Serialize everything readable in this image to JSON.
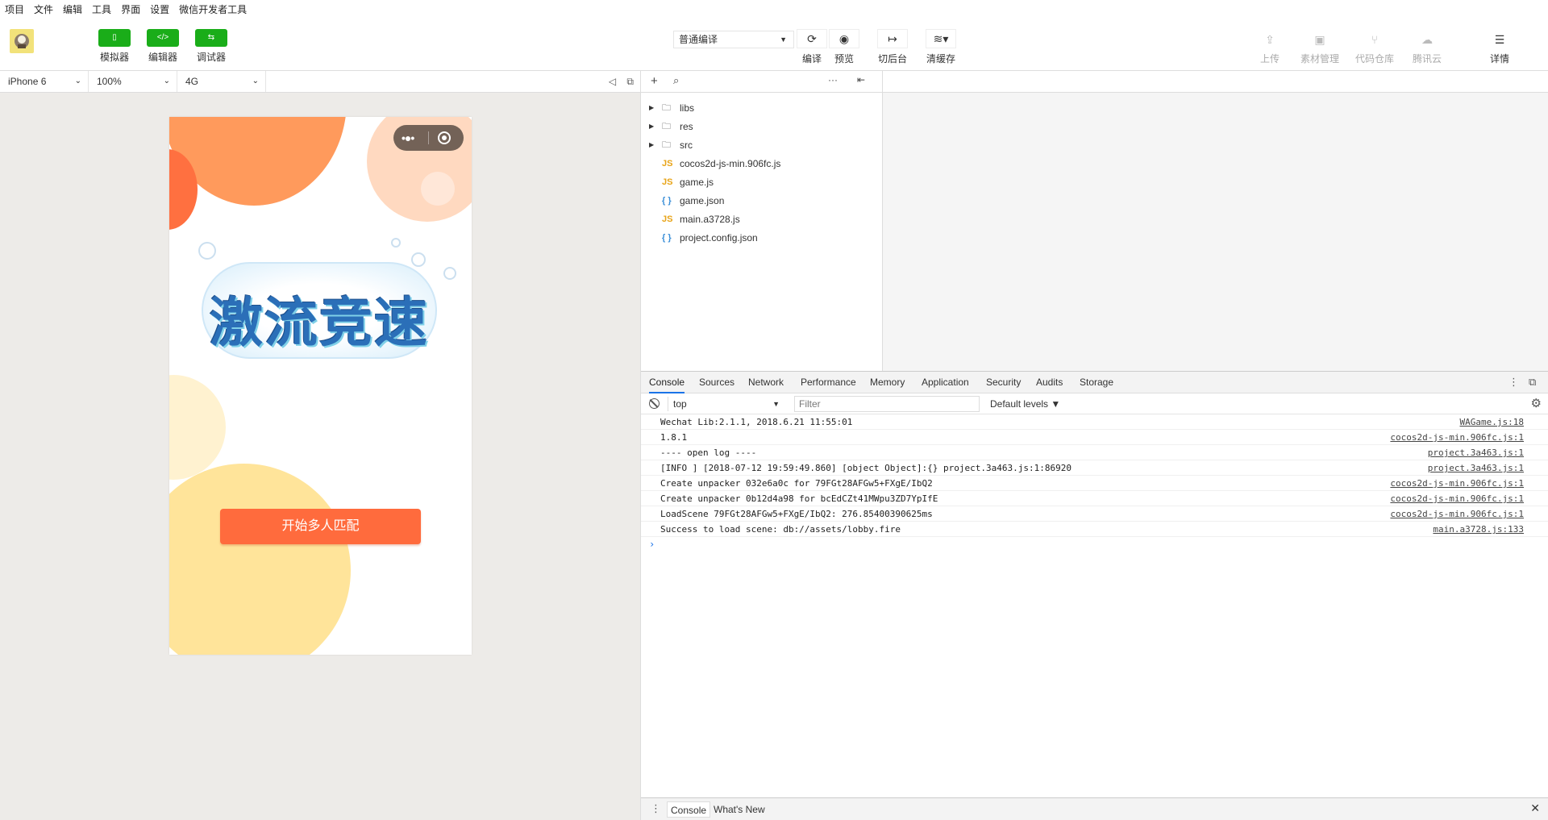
{
  "menu": [
    "项目",
    "文件",
    "编辑",
    "工具",
    "界面",
    "设置",
    "微信开发者工具"
  ],
  "toolbar": {
    "simulator_label": "模拟器",
    "editor_label": "编辑器",
    "debugger_label": "调试器",
    "compile_mode": "普通编译",
    "compile_label": "编译",
    "preview_label": "预览",
    "backend_label": "切后台",
    "cache_label": "清缓存",
    "upload_label": "上传",
    "assets_label": "素材管理",
    "repo_label": "代码仓库",
    "cloud_label": "腾讯云",
    "detail_label": "详情"
  },
  "simulator": {
    "device": "iPhone 6",
    "zoom": "100%",
    "network": "4G"
  },
  "game": {
    "logo_text": "激流竞速",
    "start_button": "开始多人匹配"
  },
  "files": [
    {
      "name": "libs",
      "type": "folder"
    },
    {
      "name": "res",
      "type": "folder"
    },
    {
      "name": "src",
      "type": "folder"
    },
    {
      "name": "cocos2d-js-min.906fc.js",
      "type": "js"
    },
    {
      "name": "game.js",
      "type": "js"
    },
    {
      "name": "game.json",
      "type": "json"
    },
    {
      "name": "main.a3728.js",
      "type": "js"
    },
    {
      "name": "project.config.json",
      "type": "json"
    }
  ],
  "devtools": {
    "tabs": [
      "Console",
      "Sources",
      "Network",
      "Performance",
      "Memory",
      "Application",
      "Security",
      "Audits",
      "Storage"
    ],
    "context": "top",
    "filter_placeholder": "Filter",
    "levels": "Default levels",
    "logs": [
      {
        "text": "Wechat Lib:2.1.1, 2018.6.21 11:55:01",
        "src": "WAGame.js:18"
      },
      {
        "text": "1.8.1",
        "src": "cocos2d-js-min.906fc.js:1"
      },
      {
        "text": "---- open log ----",
        "src": "project.3a463.js:1"
      },
      {
        "text": "[INFO ] [2018-07-12 19:59:49.860] [object Object]:{} project.3a463.js:1:86920",
        "src": "project.3a463.js:1"
      },
      {
        "text": "Create unpacker 032e6a0c for 79FGt28AFGw5+FXgE/IbQ2",
        "src": "cocos2d-js-min.906fc.js:1"
      },
      {
        "text": "Create unpacker 0b12d4a98 for bcEdCZt41MWpu3ZD7YpIfE",
        "src": "cocos2d-js-min.906fc.js:1"
      },
      {
        "text": "LoadScene 79FGt28AFGw5+FXgE/IbQ2: 276.85400390625ms",
        "src": "cocos2d-js-min.906fc.js:1"
      },
      {
        "text": "Success to load scene: db://assets/lobby.fire",
        "src": "main.a3728.js:133"
      }
    ],
    "drawer_tabs": [
      "Console",
      "What's New"
    ]
  }
}
